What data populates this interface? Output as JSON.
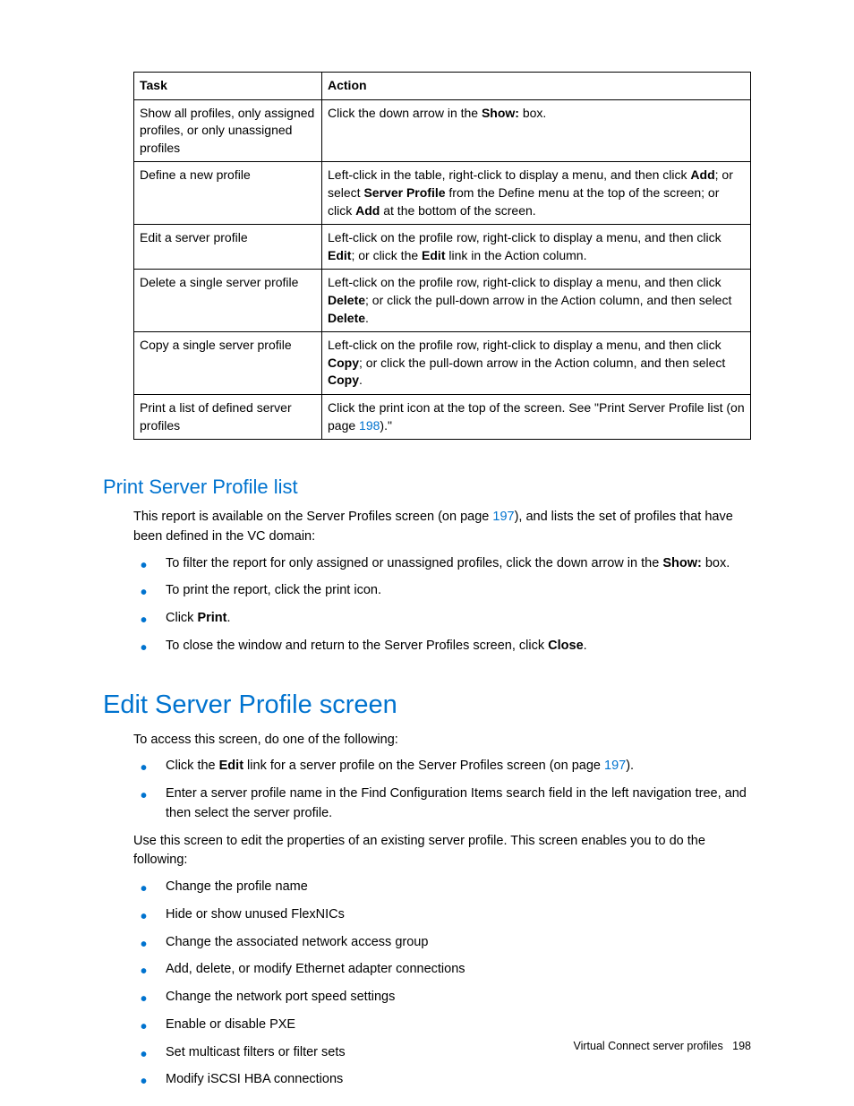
{
  "table": {
    "headers": [
      "Task",
      "Action"
    ],
    "rows": [
      {
        "task": "Show all profiles, only assigned profiles, or only unassigned profiles",
        "action_parts": [
          "Click the down arrow in the ",
          "Show:",
          " box."
        ]
      },
      {
        "task": "Define a new profile",
        "action_parts": [
          "Left-click in the table, right-click to display a menu, and then click ",
          "Add",
          "; or select ",
          "Server Profile",
          " from the Define menu at the top of the screen; or click ",
          "Add",
          " at the bottom of the screen."
        ]
      },
      {
        "task": "Edit a server profile",
        "action_parts": [
          "Left-click on the profile row, right-click to display a menu, and then click ",
          "Edit",
          "; or click the ",
          "Edit",
          " link in the Action column."
        ]
      },
      {
        "task": "Delete a single server profile",
        "action_parts": [
          "Left-click on the profile row, right-click to display a menu, and then click ",
          "Delete",
          "; or click the pull-down arrow in the Action column, and then select ",
          "Delete",
          "."
        ]
      },
      {
        "task": "Copy a single server profile",
        "action_parts": [
          "Left-click on the profile row, right-click to display a menu, and then click ",
          "Copy",
          "; or click the pull-down arrow in the Action column, and then select ",
          "Copy",
          "."
        ]
      },
      {
        "task": "Print a list of defined server profiles",
        "action_parts": [
          "Click the print icon at the top of the screen. See \"Print Server Profile list (on page ",
          "LINK:198",
          ").\""
        ]
      }
    ]
  },
  "section1": {
    "heading": "Print Server Profile list",
    "intro_pre": "This report is available on the Server Profiles screen (on page ",
    "intro_link": "197",
    "intro_post": "), and lists the set of profiles that have been defined in the VC domain:",
    "bullets": [
      {
        "pre": "To filter the report for only assigned or unassigned profiles, click the down arrow in the ",
        "bold": "Show:",
        "post": " box."
      },
      {
        "pre": "To print the report, click the print icon.",
        "bold": "",
        "post": ""
      },
      {
        "pre": "Click ",
        "bold": "Print",
        "post": "."
      },
      {
        "pre": "To close the window and return to the Server Profiles screen, click ",
        "bold": "Close",
        "post": "."
      }
    ]
  },
  "section2": {
    "heading": "Edit Server Profile screen",
    "intro": "To access this screen, do one of the following:",
    "bullets1": [
      {
        "pre": "Click the ",
        "bold": "Edit",
        "mid": " link for a server profile on the Server Profiles screen (on page ",
        "link": "197",
        "post": ")."
      },
      {
        "pre": "Enter a server profile name in the Find Configuration Items search field in the left navigation tree, and then select the server profile.",
        "bold": "",
        "mid": "",
        "link": "",
        "post": ""
      }
    ],
    "para2": "Use this screen to edit the properties of an existing server profile. This screen enables you to do the following:",
    "bullets2": [
      "Change the profile name",
      "Hide or show unused FlexNICs",
      "Change the associated network access group",
      "Add, delete, or modify Ethernet adapter connections",
      "Change the network port speed settings",
      "Enable or disable PXE",
      "Set multicast filters or filter sets",
      "Modify iSCSI HBA connections"
    ]
  },
  "footer": {
    "text": "Virtual Connect server profiles",
    "page": "198"
  }
}
